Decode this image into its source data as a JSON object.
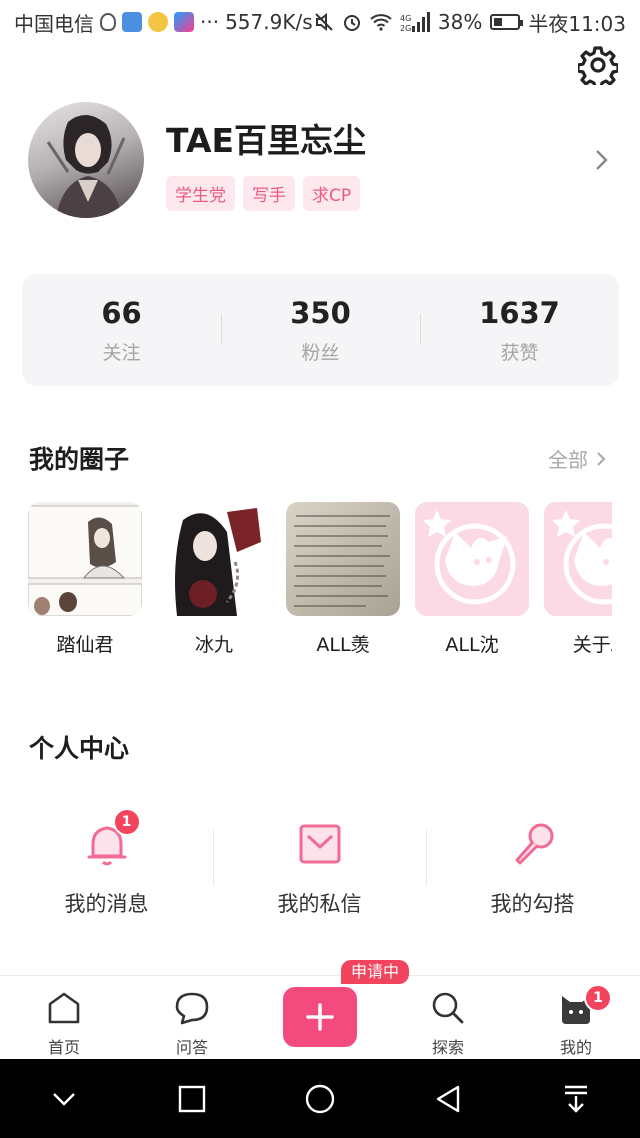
{
  "status_bar": {
    "carrier": "中国电信",
    "network_speed": "557.9K/s",
    "battery": "38%",
    "time": "半夜11:03"
  },
  "profile": {
    "name": "TAE百里忘尘",
    "tags": [
      "学生党",
      "写手",
      "求CP"
    ]
  },
  "stats": [
    {
      "value": "66",
      "label": "关注"
    },
    {
      "value": "350",
      "label": "粉丝"
    },
    {
      "value": "1637",
      "label": "获赞"
    }
  ],
  "circles_section": {
    "title": "我的圈子",
    "see_all": "全部",
    "items": [
      {
        "label": "踏仙君"
      },
      {
        "label": "冰九"
      },
      {
        "label": "ALL羡"
      },
      {
        "label": "ALL沈"
      },
      {
        "label": "关于AI"
      }
    ]
  },
  "personal_center": {
    "title": "个人中心",
    "items": [
      {
        "label": "我的消息",
        "badge": "1"
      },
      {
        "label": "我的私信"
      },
      {
        "label": "我的勾搭"
      }
    ]
  },
  "bottom_nav": {
    "applying_badge": "申请中",
    "items": [
      {
        "label": "首页"
      },
      {
        "label": "问答"
      },
      {
        "label": "探索"
      },
      {
        "label": "我的",
        "badge": "1"
      }
    ]
  },
  "colors": {
    "accent": "#f44b7f",
    "tag_bg": "#fde8ee",
    "tag_text": "#ea5a85",
    "badge": "#f2455d"
  }
}
